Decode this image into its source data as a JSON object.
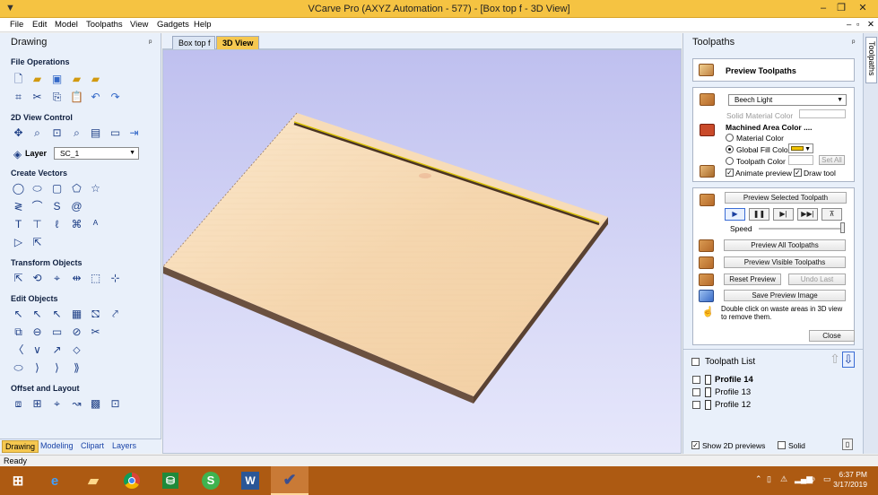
{
  "window": {
    "title": "VCarve Pro (AXYZ Automation - 577) - [Box top f - 3D View]",
    "controls": [
      "–",
      "❐",
      "✕"
    ],
    "doc_controls": [
      "–",
      "▫",
      "✕"
    ]
  },
  "menu": [
    "File",
    "Edit",
    "Model",
    "Toolpaths",
    "View",
    "Gadgets",
    "Help"
  ],
  "left_panel": {
    "title": "Drawing",
    "pin": "ᵖ",
    "sections": {
      "file_operations": "File Operations",
      "view_control": "2D View Control",
      "create_vectors": "Create Vectors",
      "transform_objects": "Transform Objects",
      "edit_objects": "Edit Objects",
      "offset_layout": "Offset and Layout"
    },
    "layer_label": "Layer",
    "layer_value": "SC_1",
    "tabs": [
      "Drawing",
      "Modeling",
      "Clipart",
      "Layers"
    ]
  },
  "doc_tabs": [
    "Box top f",
    "3D View"
  ],
  "right_panel": {
    "title": "Toolpaths",
    "pin": "ᵖ",
    "side_tab": "Toolpaths",
    "preview_header": "Preview Toolpaths",
    "material": {
      "value": "Beech Light",
      "solid_material_color": "Solid Material Color",
      "machined_area_color": "Machined Area Color ....",
      "options": [
        "Material Color",
        "Global Fill Color",
        "Toolpath Color"
      ],
      "selected_option": "Global Fill Color",
      "set_all": "Set All",
      "animate_preview": "Animate preview",
      "draw_tool": "Draw tool"
    },
    "preview_selected": "Preview Selected Toolpath",
    "playback": [
      "▶",
      "❚❚",
      "▶|",
      "▶▶|",
      "⊼"
    ],
    "speed_label": "Speed",
    "preview_all": "Preview All Toolpaths",
    "preview_visible": "Preview Visible Toolpaths",
    "reset_preview": "Reset Preview",
    "undo_last": "Undo Last",
    "save_preview": "Save Preview Image",
    "hint": "Double click on waste areas in 3D view to remove them.",
    "close": "Close",
    "toolpath_list_title": "Toolpath List",
    "toolpaths": [
      "Profile 14",
      "Profile 13",
      "Profile 12"
    ],
    "show_2d_previews": "Show 2D previews",
    "solid": "Solid"
  },
  "status": {
    "text": "Ready"
  },
  "taskbar": {
    "time": "6:37 PM",
    "date": "3/17/2019"
  },
  "colors": {
    "title_bar": "#f5c342",
    "accent": "#f6c850",
    "taskbar": "#ad5a12",
    "viewport": "#c8c9f2",
    "wood": "#f6d9b3"
  }
}
